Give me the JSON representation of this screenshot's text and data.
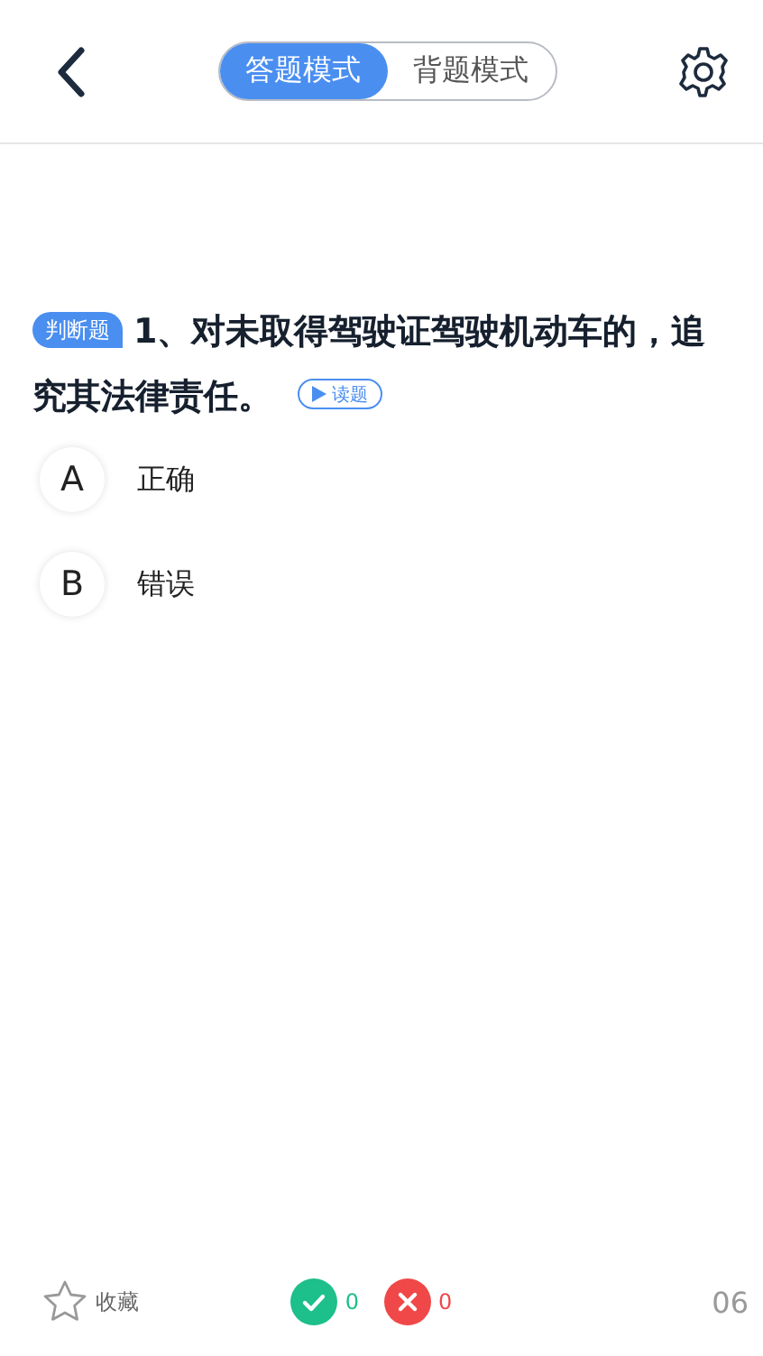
{
  "modes": [
    {
      "label": "答题模式",
      "selected": true
    },
    {
      "label": "背题模式",
      "selected": false
    }
  ],
  "question": {
    "type_tag": "判断题",
    "text": "1、对未取得驾驶证驾驶机动车的，追究其法律责任。",
    "read_button": "读题"
  },
  "options": [
    {
      "letter": "A",
      "text": "正确"
    },
    {
      "letter": "B",
      "text": "错误"
    }
  ],
  "bottom_bar": {
    "favorite": "收藏",
    "correct_count": "0",
    "wrong_count": "0",
    "progress": "06"
  }
}
